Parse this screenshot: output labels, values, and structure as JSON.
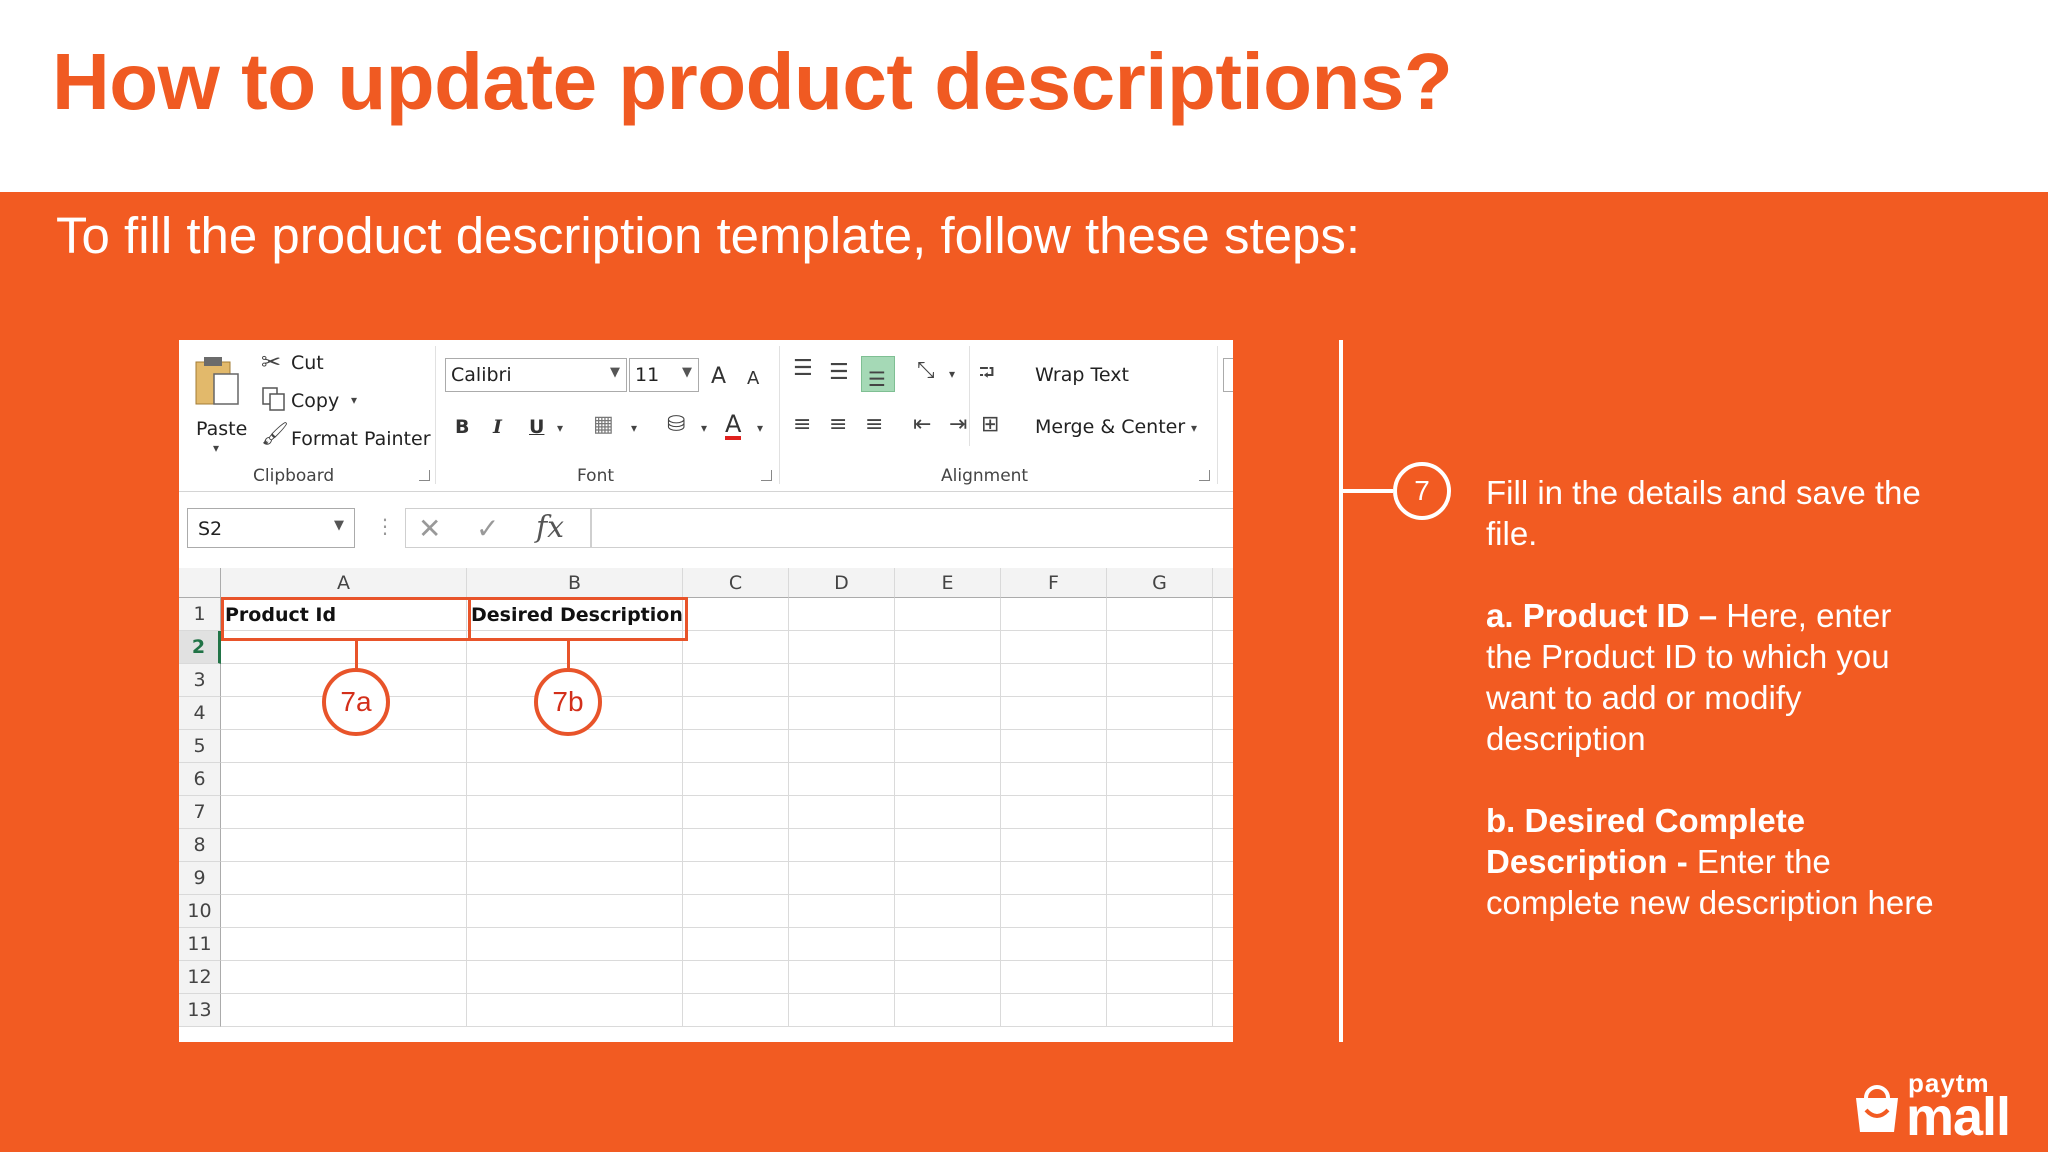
{
  "slide": {
    "title": "How to update product descriptions?",
    "subtitle": "To fill the product description template, follow these steps:",
    "colors": {
      "accent": "#f25b22",
      "title": "#f05a22"
    }
  },
  "excel": {
    "clipboard": {
      "paste_label": "Paste",
      "cut_label": "Cut",
      "copy_label": "Copy",
      "format_painter_label": "Format Painter",
      "group_label": "Clipboard"
    },
    "font": {
      "font_name": "Calibri",
      "font_size": "11",
      "grow_label": "A",
      "shrink_label": "A",
      "bold_label": "B",
      "italic_label": "I",
      "underline_label": "U",
      "font_color_label": "A",
      "group_label": "Font"
    },
    "alignment": {
      "wrap_text_label": "Wrap Text",
      "merge_center_label": "Merge & Center",
      "group_label": "Alignment"
    },
    "formula_bar": {
      "name_box": "S2",
      "cancel_glyph": "✕",
      "enter_glyph": "✓",
      "fx_label": "fx"
    },
    "columns": [
      "A",
      "B",
      "C",
      "D",
      "E",
      "F",
      "G"
    ],
    "rows": [
      "1",
      "2",
      "3",
      "4",
      "5",
      "6",
      "7",
      "8",
      "9",
      "10",
      "11",
      "12",
      "13"
    ],
    "cells": {
      "a1": "Product Id",
      "b1": "Desired Description"
    },
    "callouts": {
      "a": "7a",
      "b": "7b"
    }
  },
  "instructions": {
    "step_number": "7",
    "intro": "Fill in the details and save the file.",
    "a_label": "a. Product ID –",
    "a_text": " Here, enter the Product ID to which you want to add or modify description",
    "b_label": "b. Desired Complete Description -",
    "b_text": " Enter the complete new description here"
  },
  "logo": {
    "top_text": "paytm",
    "bottom_text": "mall",
    "icon": "shopping-bag-icon"
  }
}
